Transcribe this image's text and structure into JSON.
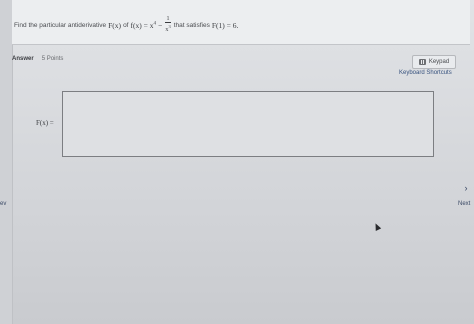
{
  "question": {
    "intro": "Find the particular antiderivative",
    "F_of_x": "F(x)",
    "of_word": "of",
    "f_equals": "f(x) = x",
    "exponent": "4",
    "minus": "−",
    "frac_num": "1",
    "frac_den": "x",
    "frac_den_exp": "3",
    "that_satisfies": "that satisfies",
    "condition": "F(1) = 6."
  },
  "answer": {
    "label": "Answer",
    "points": "5 Points",
    "input_label": "F(x) ="
  },
  "toolbar": {
    "keypad_label": "Keypad",
    "shortcuts_label": "Keyboard Shortcuts"
  },
  "nav": {
    "prev_label": "ev",
    "next_label": "Next",
    "next_icon": "chevron-right-icon"
  }
}
